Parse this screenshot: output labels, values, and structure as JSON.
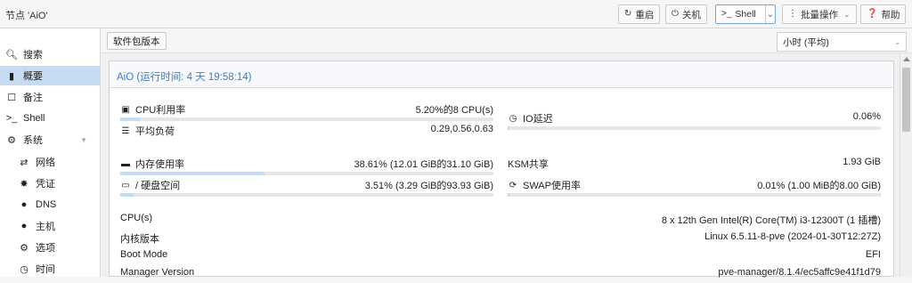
{
  "header": {
    "title": "节点 'AiO'",
    "buttons": {
      "reboot": "重启",
      "shutdown": "关机",
      "shell": "Shell",
      "bulk": "批量操作",
      "help": "帮助"
    }
  },
  "sidebar": {
    "items": [
      {
        "label": "搜索",
        "icon": "search-icon"
      },
      {
        "label": "概要",
        "icon": "book-icon"
      },
      {
        "label": "备注",
        "icon": "note-icon"
      },
      {
        "label": "Shell",
        "icon": "terminal-icon"
      },
      {
        "label": "系统",
        "icon": "gears-icon"
      },
      {
        "label": "网络",
        "icon": "network-icon"
      },
      {
        "label": "凭证",
        "icon": "certificate-icon"
      },
      {
        "label": "DNS",
        "icon": "globe-icon"
      },
      {
        "label": "主机",
        "icon": "globe-icon"
      },
      {
        "label": "选项",
        "icon": "gear-icon"
      },
      {
        "label": "时间",
        "icon": "clock-icon"
      }
    ]
  },
  "toolbar": {
    "package_versions": "软件包版本",
    "timeframe": "小时 (平均)"
  },
  "panel": {
    "title": "AiO (运行时间: 4 天 19:58:14)",
    "cpu": {
      "label": "CPU利用率",
      "value": "5.20%的8 CPU(s)",
      "percent": 5.2
    },
    "load": {
      "label": "平均负荷",
      "value": "0.29,0.56,0.63"
    },
    "io": {
      "label": "IO延迟",
      "value": "0.06%",
      "percent": 0.06
    },
    "memory": {
      "label": "内存使用率",
      "value": "38.61% (12.01 GiB的31.10 GiB)",
      "percent": 38.61
    },
    "ksm": {
      "label": "KSM共享",
      "value": "1.93 GiB"
    },
    "disk": {
      "label": "/ 硬盘空间",
      "value": "3.51% (3.29 GiB的93.93 GiB)",
      "percent": 3.51
    },
    "swap": {
      "label": "SWAP使用率",
      "value": "0.01% (1.00 MiB的8.00 GiB)",
      "percent": 0.01
    },
    "info": [
      {
        "key": "CPU(s)",
        "value": "8 x 12th Gen Intel(R) Core(TM) i3-12300T (1 插槽)"
      },
      {
        "key": "内核版本",
        "value": "Linux 6.5.11-8-pve (2024-01-30T12:27Z)"
      },
      {
        "key": "Boot Mode",
        "value": "EFI"
      },
      {
        "key": "Manager Version",
        "value": "pve-manager/8.1.4/ec5affc9e41f1d79"
      }
    ]
  }
}
